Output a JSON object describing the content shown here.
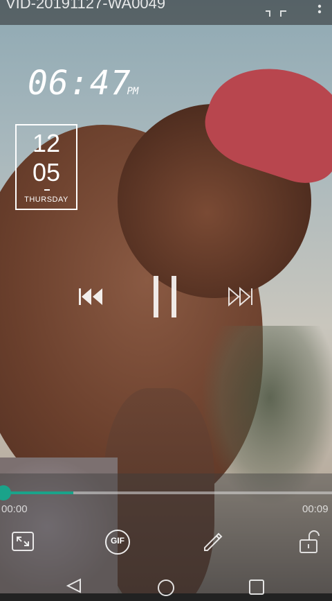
{
  "header": {
    "title": "VID-20191127-WA0049",
    "crop_icon": "crop-icon",
    "more_icon": "more-vert-icon"
  },
  "overlay": {
    "clock": {
      "time": "06:47",
      "ampm": "PM"
    },
    "date": {
      "line1": "12",
      "line2": "05",
      "day": "THURSDAY"
    }
  },
  "controls": {
    "prev_icon": "skip-previous-icon",
    "pause_icon": "pause-icon",
    "next_icon": "skip-next-icon"
  },
  "progress": {
    "current": "00:00",
    "total": "00:09",
    "played_fraction": 0.21,
    "accent": "#1aa38a"
  },
  "toolbar": {
    "fullscreen_icon": "fullscreen-icon",
    "gif_label": "GIF",
    "edit_icon": "pencil-icon",
    "lock_icon": "unlock-icon"
  },
  "navigation": {
    "back_icon": "back-icon",
    "home_icon": "home-icon",
    "recent_icon": "recent-apps-icon"
  }
}
